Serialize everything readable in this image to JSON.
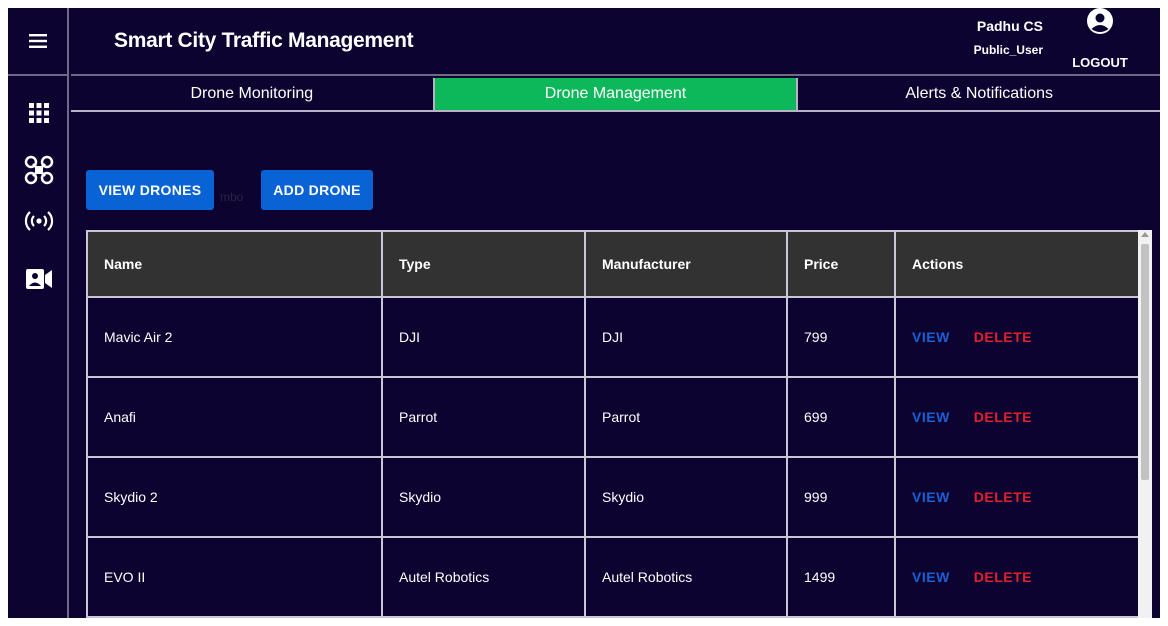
{
  "header": {
    "title": "Smart City Traffic Management",
    "user_name": "Padhu CS",
    "user_role": "Public_User",
    "logout_label": "LOGOUT"
  },
  "rail": {
    "icons": [
      "menu-icon",
      "apps-grid-icon",
      "drone-icon",
      "broadcast-icon",
      "video-camera-icon"
    ]
  },
  "tabs": [
    {
      "label": "Drone Monitoring",
      "active": false
    },
    {
      "label": "Drone Management",
      "active": true
    },
    {
      "label": "Alerts & Notifications",
      "active": false
    }
  ],
  "actions": {
    "view_drones": "VIEW DRONES",
    "add_drone": "ADD DRONE",
    "stray_text": "mbo"
  },
  "table": {
    "columns": [
      "Name",
      "Type",
      "Manufacturer",
      "Price",
      "Actions"
    ],
    "view_label": "VIEW",
    "delete_label": "DELETE",
    "rows": [
      {
        "name": "Mavic Air 2",
        "type": "DJI",
        "manufacturer": "DJI",
        "price": "799"
      },
      {
        "name": "Anafi",
        "type": "Parrot",
        "manufacturer": "Parrot",
        "price": "699"
      },
      {
        "name": "Skydio 2",
        "type": "Skydio",
        "manufacturer": "Skydio",
        "price": "999"
      },
      {
        "name": "EVO II",
        "type": "Autel Robotics",
        "manufacturer": "Autel Robotics",
        "price": "1499"
      }
    ]
  },
  "colors": {
    "background": "#0c0330",
    "active_tab": "#0cb85a",
    "button": "#0a63d4",
    "table_header": "#323232",
    "view_action": "#1a5fd6",
    "delete_action": "#e0202e"
  }
}
